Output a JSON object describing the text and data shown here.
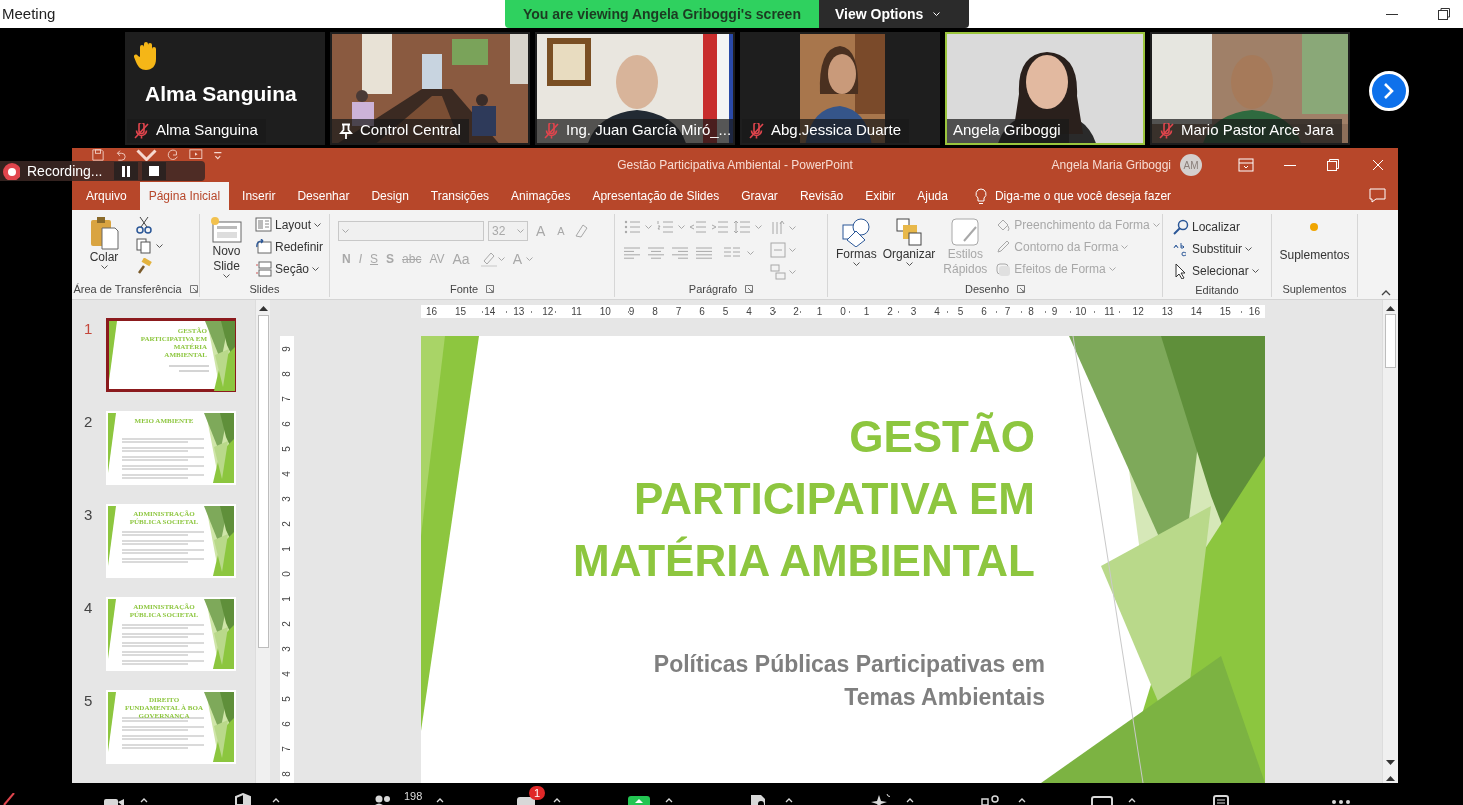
{
  "window": {
    "title": "Meeting"
  },
  "share_banner": {
    "text": "You are viewing Angela Griboggi's screen",
    "options": "View Options"
  },
  "participants": [
    {
      "name": "Alma Sanguina",
      "display_name": "Alma Sanguina",
      "kind": "avatar",
      "muted": true,
      "pinned": false,
      "hand_raised": true,
      "active": false
    },
    {
      "name": "Control Central",
      "kind": "video",
      "muted": false,
      "pinned": true,
      "hand_raised": false,
      "active": false
    },
    {
      "name": "Ing. Juan García Miró_...",
      "kind": "video",
      "muted": true,
      "pinned": false,
      "hand_raised": false,
      "active": false
    },
    {
      "name": "Abg.Jessica Duarte",
      "kind": "video",
      "muted": true,
      "pinned": false,
      "hand_raised": false,
      "active": false
    },
    {
      "name": "Angela Griboggi",
      "kind": "video",
      "muted": false,
      "pinned": false,
      "hand_raised": false,
      "active": true
    },
    {
      "name": "Mario Pastor Arce Jara",
      "kind": "video",
      "muted": true,
      "pinned": false,
      "hand_raised": false,
      "active": false
    }
  ],
  "recording": {
    "text": "Recording..."
  },
  "ppt": {
    "title": "Gestão Participativa  Ambiental  -  PowerPoint",
    "user": "Angela Maria Griboggi",
    "initials": "AM",
    "tabs": [
      {
        "label": "Arquivo",
        "selected": false
      },
      {
        "label": "Página Inicial",
        "selected": true
      },
      {
        "label": "Inserir",
        "selected": false
      },
      {
        "label": "Desenhar",
        "selected": false
      },
      {
        "label": "Design",
        "selected": false
      },
      {
        "label": "Transições",
        "selected": false
      },
      {
        "label": "Animações",
        "selected": false
      },
      {
        "label": "Apresentação de Slides",
        "selected": false
      },
      {
        "label": "Gravar",
        "selected": false
      },
      {
        "label": "Revisão",
        "selected": false
      },
      {
        "label": "Exibir",
        "selected": false
      },
      {
        "label": "Ajuda",
        "selected": false
      }
    ],
    "tell_me": "Diga-me o que você deseja fazer",
    "ribbon": {
      "clipboard": {
        "label": "Área de Transferência",
        "paste": "Colar"
      },
      "slides": {
        "label": "Slides",
        "new_slide": "Novo Slide",
        "commands": [
          "Layout",
          "Redefinir",
          "Seção"
        ]
      },
      "font": {
        "label": "Fonte",
        "size": "32",
        "format_buttons": [
          "N",
          "I",
          "S",
          "S",
          "abc",
          "AV",
          "Aa"
        ],
        "grow": "A",
        "shrink": "A",
        "color_letter": "A",
        "disabled": true
      },
      "paragraph": {
        "label": "Parágrafo",
        "disabled": true
      },
      "drawing": {
        "label": "Desenho",
        "shapes": "Formas",
        "arrange": "Organizar",
        "quick_styles": "Estilos Rápidos",
        "style_commands": [
          "Preenchimento da Forma",
          "Contorno da Forma",
          "Efeitos de Forma"
        ],
        "styles_disabled": true
      },
      "editing": {
        "label": "Editando",
        "commands": [
          "Localizar",
          "Substituir",
          "Selecionar"
        ]
      },
      "addins": {
        "label": "Suplementos",
        "button": "Suplementos"
      }
    },
    "thumbnails": [
      {
        "number": "1",
        "kind": "title",
        "title": "GESTÃO PARTICIPATIVA EM MATÉRIA AMBIENTAL",
        "selected": true
      },
      {
        "number": "2",
        "kind": "content",
        "title": "MEIO AMBIENTE",
        "selected": false
      },
      {
        "number": "3",
        "kind": "content",
        "title": "ADMINISTRAÇÃO PÚBLICA SOCIETAL",
        "selected": false
      },
      {
        "number": "4",
        "kind": "content",
        "title": "ADMINISTRAÇÃO PÚBLICA SOCIETAL",
        "selected": false
      },
      {
        "number": "5",
        "kind": "content",
        "title": "DIREITO FUNDAMENTAL À BOA GOVERNANÇA",
        "selected": false
      }
    ],
    "ruler_h": [
      "16",
      "15",
      "14",
      "13",
      "12",
      "11",
      "10",
      "9",
      "8",
      "7",
      "6",
      "5",
      "4",
      "3",
      "2",
      "1",
      "0",
      "1",
      "2",
      "3",
      "4",
      "5",
      "6",
      "7",
      "8",
      "9",
      "10",
      "11",
      "12",
      "13",
      "14",
      "15",
      "16"
    ],
    "ruler_v": [
      "9",
      "8",
      "7",
      "6",
      "5",
      "4",
      "3",
      "2",
      "1",
      "0",
      "1",
      "2",
      "3",
      "4",
      "5",
      "6",
      "7",
      "8"
    ],
    "slide": {
      "title_lines": [
        "GESTÃO",
        "PARTICIPATIVA EM",
        "MATÉRIA AMBIENTAL"
      ],
      "subtitle_lines": [
        "Políticas Públicas Participativas em",
        "Temas Ambientais"
      ]
    }
  },
  "toolbar": {
    "participants_count": "198",
    "chat_badge": "1"
  }
}
